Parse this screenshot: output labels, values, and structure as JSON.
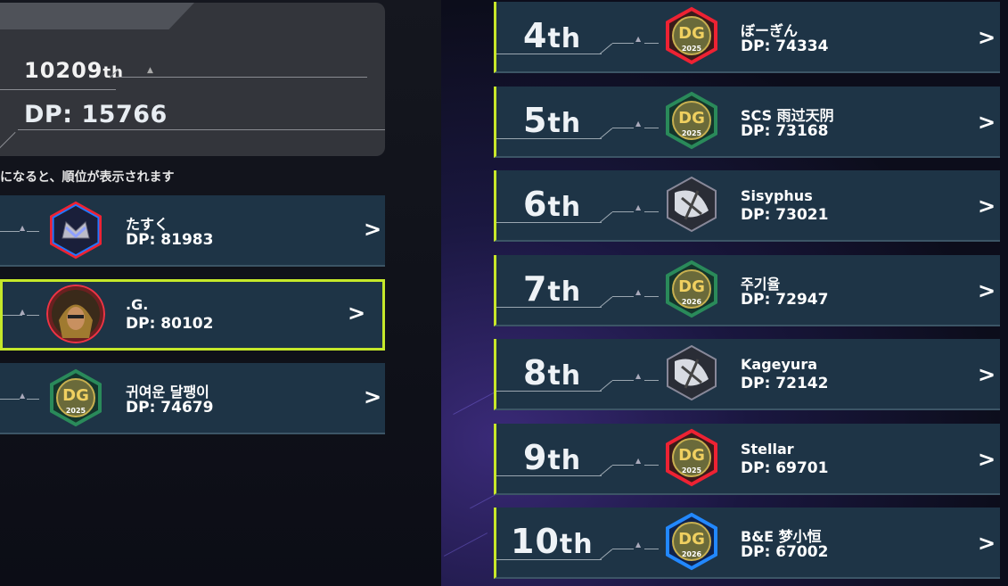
{
  "my_rank": {
    "rank": "10209",
    "rank_suffix": "th",
    "dp": "DP: 15766"
  },
  "notice": "になると、順位が表示されます",
  "left_rows": [
    {
      "name": "たすく",
      "dp": "DP: 81983",
      "icon": "crest-crown-icon",
      "selected": false
    },
    {
      "name": ".G.",
      "dp": "DP: 80102",
      "icon": "character-portrait-icon",
      "selected": true
    },
    {
      "name": "귀여운 달팽이",
      "dp": "DP: 74679",
      "icon": "dg-2025-dec-green-icon",
      "selected": false
    }
  ],
  "right_rows": [
    {
      "rank": "4",
      "suffix": "th",
      "name": "ぼーぎん",
      "dp": "DP: 74334",
      "icon": "dg-2025-dec-red-icon"
    },
    {
      "rank": "5",
      "suffix": "th",
      "name": "SCS 雨过天阴",
      "dp": "DP: 73168",
      "icon": "dg-2025-dec-green-icon"
    },
    {
      "rank": "6",
      "suffix": "th",
      "name": "Sisyphus",
      "dp": "DP: 73021",
      "icon": "monster-portrait-icon"
    },
    {
      "rank": "7",
      "suffix": "th",
      "name": "주기율",
      "dp": "DP: 72947",
      "icon": "dg-2026-mar-green-icon"
    },
    {
      "rank": "8",
      "suffix": "th",
      "name": "Kageyura",
      "dp": "DP: 72142",
      "icon": "monster-portrait-icon"
    },
    {
      "rank": "9",
      "suffix": "th",
      "name": "Stellar",
      "dp": "DP: 69701",
      "icon": "dg-2025-dec-red-icon"
    },
    {
      "rank": "10",
      "suffix": "th",
      "name": "B&E 梦小恒",
      "dp": "DP: 67002",
      "icon": "dg-2026-mar-blue-icon"
    }
  ],
  "colors": {
    "accent": "#c8e62a",
    "row_bg": "#1e3446"
  },
  "chevron": ">"
}
